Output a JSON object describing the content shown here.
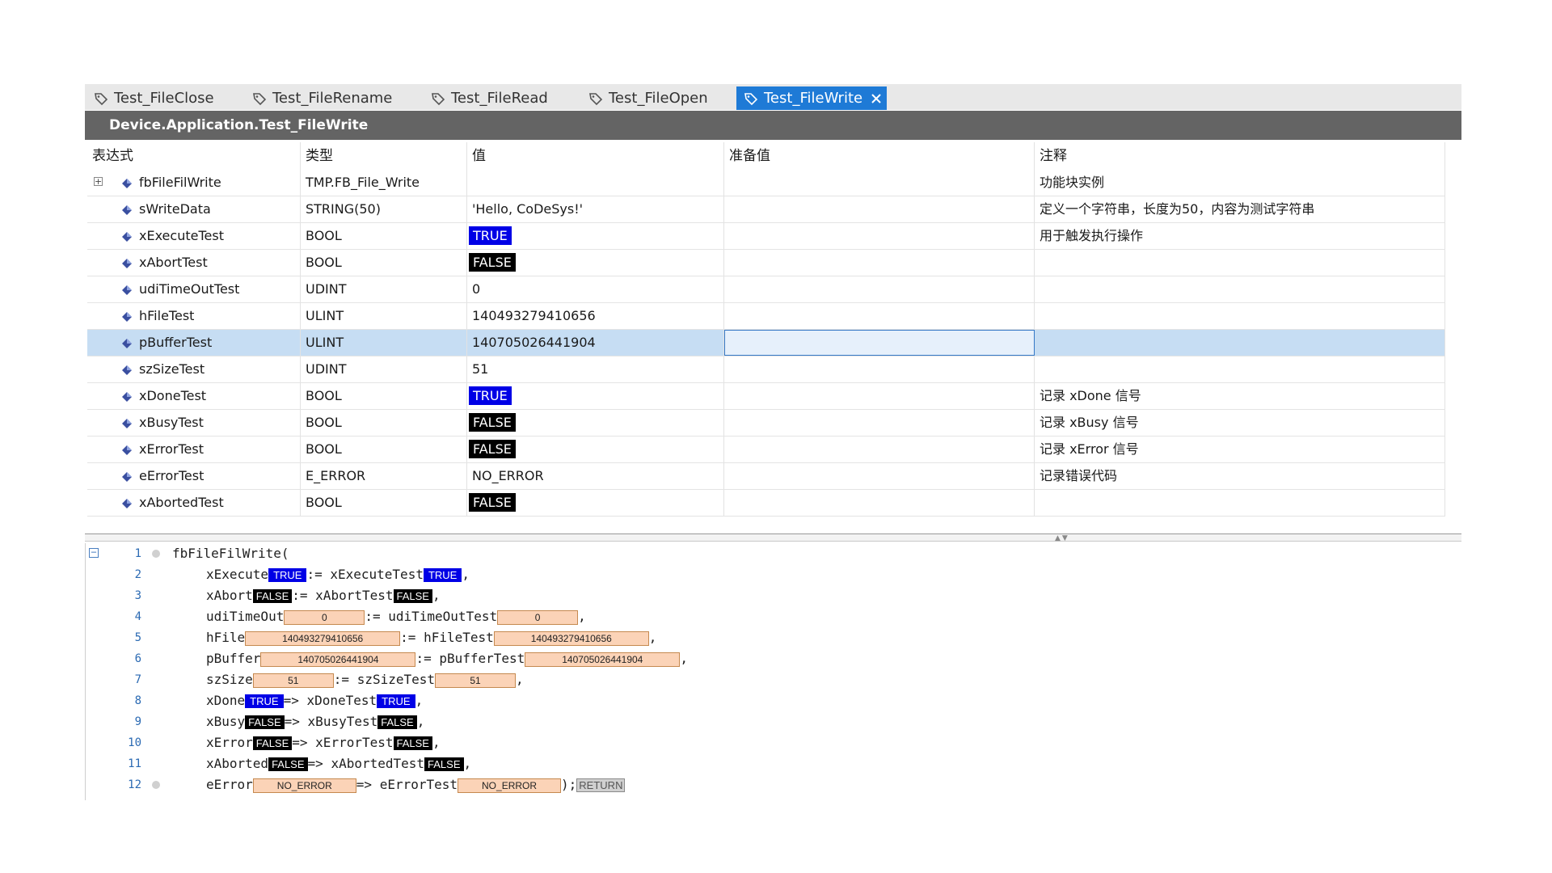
{
  "tabs": [
    {
      "label": "Test_FileClose",
      "active": false
    },
    {
      "label": "Test_FileRename",
      "active": false
    },
    {
      "label": "Test_FileRead",
      "active": false
    },
    {
      "label": "Test_FileOpen",
      "active": false
    },
    {
      "label": "Test_FileWrite",
      "active": true
    }
  ],
  "header": {
    "path": "Device.Application.Test_FileWrite"
  },
  "columns": {
    "expression": "表达式",
    "type": "类型",
    "value": "值",
    "prepared": "准备值",
    "comment": "注释"
  },
  "rows": [
    {
      "expr": "fbFileFilWrite",
      "type": "TMP.FB_File_Write",
      "value": "",
      "prepared": "",
      "comment": "功能块实例"
    },
    {
      "expr": "sWriteData",
      "type": "STRING(50)",
      "value": "'Hello, CoDeSys!'",
      "prepared": "",
      "comment": "定义一个字符串，长度为50，内容为测试字符串"
    },
    {
      "expr": "xExecuteTest",
      "type": "BOOL",
      "value": "TRUE",
      "prepared": "",
      "comment": "用于触发执行操作"
    },
    {
      "expr": "xAbortTest",
      "type": "BOOL",
      "value": "FALSE",
      "prepared": "",
      "comment": ""
    },
    {
      "expr": "udiTimeOutTest",
      "type": "UDINT",
      "value": "0",
      "prepared": "",
      "comment": ""
    },
    {
      "expr": "hFileTest",
      "type": "ULINT",
      "value": "140493279410656",
      "prepared": "",
      "comment": ""
    },
    {
      "expr": "pBufferTest",
      "type": "ULINT",
      "value": "140705026441904",
      "prepared": "",
      "comment": ""
    },
    {
      "expr": "szSizeTest",
      "type": "UDINT",
      "value": "51",
      "prepared": "",
      "comment": ""
    },
    {
      "expr": "xDoneTest",
      "type": "BOOL",
      "value": "TRUE",
      "prepared": "",
      "comment": "记录 xDone 信号"
    },
    {
      "expr": "xBusyTest",
      "type": "BOOL",
      "value": "FALSE",
      "prepared": "",
      "comment": "记录 xBusy 信号"
    },
    {
      "expr": "xErrorTest",
      "type": "BOOL",
      "value": "FALSE",
      "prepared": "",
      "comment": "记录 xError 信号"
    },
    {
      "expr": "eErrorTest",
      "type": "E_ERROR",
      "value": "NO_ERROR",
      "prepared": "",
      "comment": "记录错误代码"
    },
    {
      "expr": "xAbortedTest",
      "type": "BOOL",
      "value": "FALSE",
      "prepared": "",
      "comment": ""
    }
  ],
  "code": {
    "line_numbers": [
      "1",
      "2",
      "3",
      "4",
      "5",
      "6",
      "7",
      "8",
      "9",
      "10",
      "11",
      "12"
    ],
    "l1": "fbFileFilWrite(",
    "l2": {
      "a": "xExecute",
      "v1": "TRUE",
      "op": ":= ",
      "b": "xExecuteTest",
      "v2": "TRUE",
      "end": ","
    },
    "l3": {
      "a": "xAbort",
      "v1": "FALSE",
      "op": ":= ",
      "b": "xAbortTest",
      "v2": "FALSE",
      "end": ","
    },
    "l4": {
      "a": "udiTimeOut",
      "v1": "0",
      "op": ":= ",
      "b": "udiTimeOutTest",
      "v2": "0",
      "end": ","
    },
    "l5": {
      "a": "hFile",
      "v1": "140493279410656",
      "op": ":= ",
      "b": "hFileTest",
      "v2": "140493279410656",
      "end": ","
    },
    "l6": {
      "a": "pBuffer",
      "v1": "140705026441904",
      "op": ":= ",
      "b": "pBufferTest",
      "v2": "140705026441904",
      "end": ","
    },
    "l7": {
      "a": "szSize",
      "v1": "51",
      "op": ":= ",
      "b": "szSizeTest",
      "v2": "51",
      "end": ","
    },
    "l8": {
      "a": "xDone",
      "v1": "TRUE",
      "op": "=> ",
      "b": "xDoneTest",
      "v2": "TRUE",
      "end": ","
    },
    "l9": {
      "a": "xBusy",
      "v1": "FALSE",
      "op": "=> ",
      "b": "xBusyTest",
      "v2": "FALSE",
      "end": ","
    },
    "l10": {
      "a": "xError",
      "v1": "FALSE",
      "op": "=> ",
      "b": "xErrorTest",
      "v2": "FALSE",
      "end": ","
    },
    "l11": {
      "a": "xAborted",
      "v1": "FALSE",
      "op": "=> ",
      "b": "xAbortedTest",
      "v2": "FALSE",
      "end": ","
    },
    "l12": {
      "a": "eError",
      "v1": "NO_ERROR",
      "op": "=> ",
      "b": "eErrorTest",
      "v2": "NO_ERROR",
      "end": ");",
      "ret": "RETURN"
    }
  },
  "colors": {
    "tab_active": "#1e7ad6",
    "header_bg": "#646464",
    "true_bg": "#0000e6",
    "false_bg": "#000000",
    "value_box": "#fbd3b7",
    "selection": "#c6ddf3"
  }
}
